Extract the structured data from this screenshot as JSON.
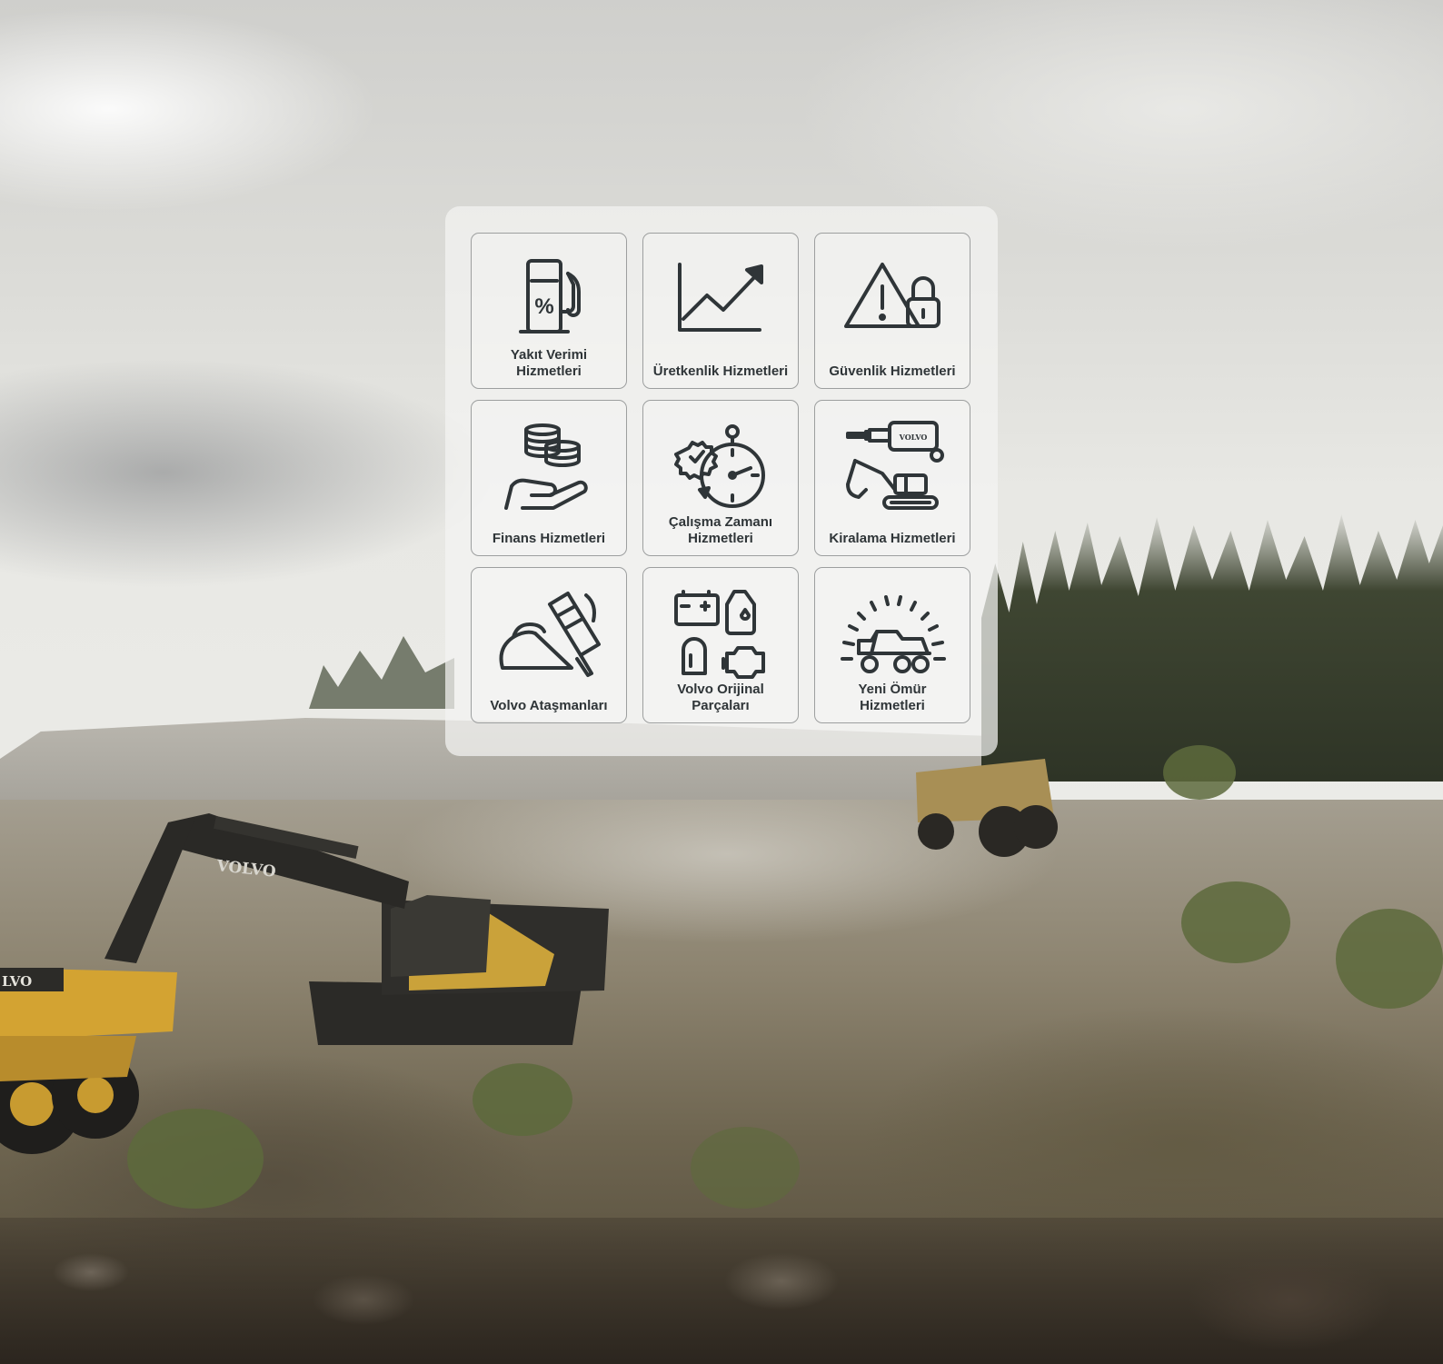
{
  "services": [
    {
      "label": "Yakıt Verimi\nHizmetleri",
      "icon": "fuel-efficiency-icon"
    },
    {
      "label": "Üretkenlik Hizmetleri",
      "icon": "productivity-chart-icon"
    },
    {
      "label": "Güvenlik Hizmetleri",
      "icon": "safety-warning-lock-icon"
    },
    {
      "label": "Finans Hizmetleri",
      "icon": "finance-coins-hand-icon"
    },
    {
      "label": "Çalışma Zamanı\nHizmetleri",
      "icon": "uptime-gear-stopwatch-icon"
    },
    {
      "label": "Kiralama Hizmetleri",
      "icon": "rental-key-excavator-icon"
    },
    {
      "label": "Volvo Ataşmanları",
      "icon": "attachments-bucket-hammer-icon"
    },
    {
      "label": "Volvo Orijinal\nParçaları",
      "icon": "genuine-parts-icon"
    },
    {
      "label": "Yeni Ömür\nHizmetleri",
      "icon": "new-life-truck-icon"
    }
  ],
  "icon_text": {
    "key_brand": "VOLVO",
    "fuel_percent": "%"
  },
  "background_text": {
    "excavator_brand": "VOLVO",
    "truck_brand": "LVO"
  },
  "colors": {
    "icon_stroke": "#2f3538",
    "panel": "#f4f4f2",
    "tile_border": "#9d9f9f"
  }
}
